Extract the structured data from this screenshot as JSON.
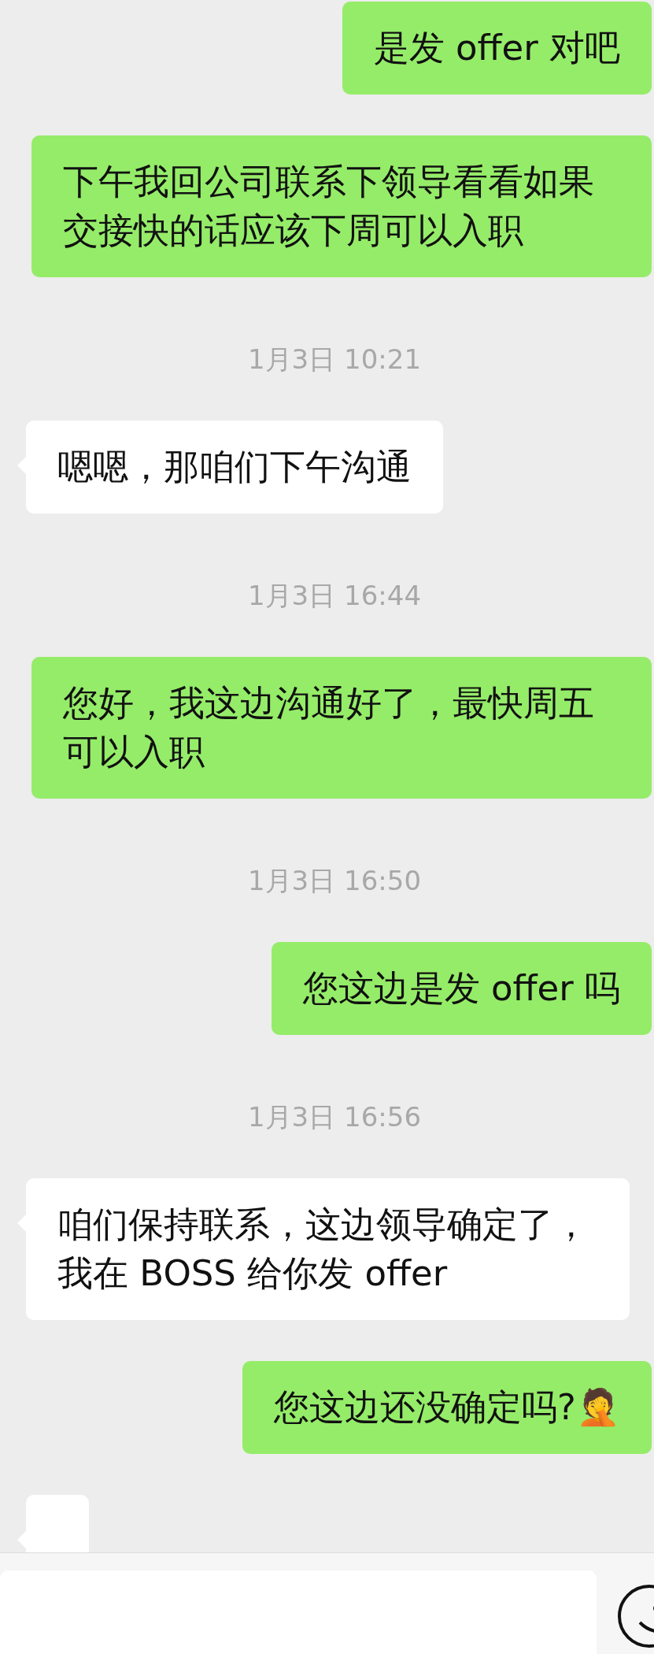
{
  "messages": [
    {
      "kind": "sent",
      "text": "是发 offer 对吧"
    },
    {
      "kind": "sent",
      "text": "下午我回公司联系下领导看看如果交接快的话应该下周可以入职"
    },
    {
      "kind": "time",
      "text": "1月3日 10:21"
    },
    {
      "kind": "received",
      "text": "嗯嗯，那咱们下午沟通"
    },
    {
      "kind": "time",
      "text": "1月3日 16:44"
    },
    {
      "kind": "sent",
      "text": "您好，我这边沟通好了，最快周五可以入职"
    },
    {
      "kind": "time",
      "text": "1月3日 16:50"
    },
    {
      "kind": "sent",
      "text": "您这边是发 offer 吗"
    },
    {
      "kind": "time",
      "text": "1月3日 16:56"
    },
    {
      "kind": "received",
      "text": "咱们保持联系，这边领导确定了，我在 BOSS 给你发 offer"
    },
    {
      "kind": "sent",
      "text": "您这边还没确定吗?🤦"
    },
    {
      "kind": "received"
    }
  ]
}
